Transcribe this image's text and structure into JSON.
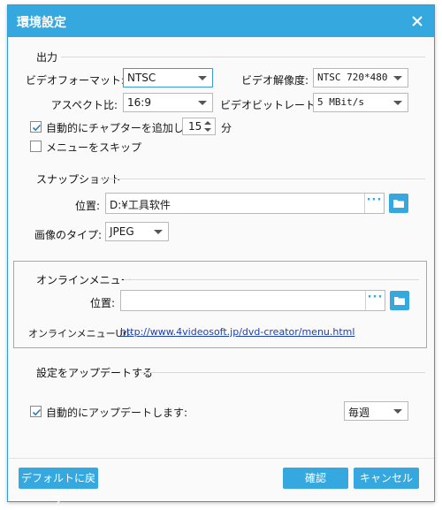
{
  "dialog": {
    "title": "環境設定"
  },
  "output": {
    "section_label": "出力",
    "video_format_label": "ビデオフォーマット:",
    "video_format_value": "NTSC",
    "video_resolution_label": "ビデオ解像度:",
    "video_resolution_value": "NTSC 720*480",
    "aspect_label": "アスペクト比:",
    "aspect_value": "16:9",
    "bitrate_label": "ビデオビットレート:",
    "bitrate_value": "5 MBit/s",
    "auto_chapter_label": "自動的にチャプターを追加します",
    "auto_chapter_checked": true,
    "chapter_minutes": "15",
    "minutes_unit": "分",
    "skip_menu_label": "メニューをスキップ",
    "skip_menu_checked": false
  },
  "snapshot": {
    "section_label": "スナップショット",
    "location_label": "位置:",
    "location_value": "D:¥工具软件",
    "image_type_label": "画像のタイプ:",
    "image_type_value": "JPEG",
    "dots": "···"
  },
  "online_menu": {
    "section_label": "オンラインメニュー",
    "location_label": "位置:",
    "location_value": "",
    "url_label": "オンラインメニューUrl:",
    "url_value": "http://www.4videosoft.jp/dvd-creator/menu.html",
    "dots": "···"
  },
  "update": {
    "section_label": "設定をアップデートする",
    "auto_update_label": "自動的にアップデートします:",
    "auto_update_checked": true,
    "frequency_value": "毎週"
  },
  "footer": {
    "default_label": "デフォルトに戻す",
    "ok_label": "確認",
    "cancel_label": "キャンセル"
  },
  "colors": {
    "accent": "#35a8e0",
    "link": "#1a3fb5"
  }
}
